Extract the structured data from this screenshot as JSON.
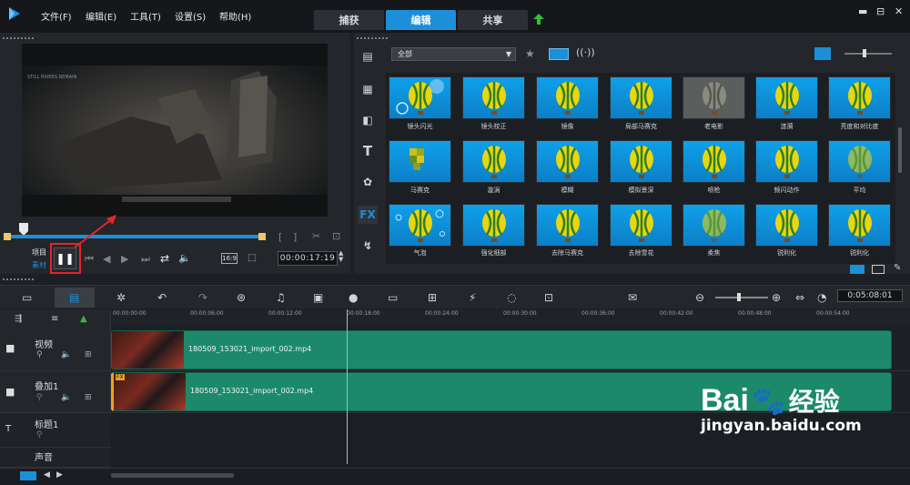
{
  "menu": [
    "文件(F)",
    "编辑(E)",
    "工具(T)",
    "设置(S)",
    "帮助(H)"
  ],
  "tabs": [
    "捕获",
    "编辑",
    "共享"
  ],
  "active_tab": "编辑",
  "window": {
    "min": "▬",
    "restore": "⊟",
    "close": "✕"
  },
  "preview": {
    "project_label": "项目",
    "clip_label": "素材",
    "timecode": "00:00:17:19",
    "ratio": "16:9",
    "watermark_text": "STILL RIVERS REMAIN"
  },
  "library": {
    "filter_value": "全部",
    "side_tabs": [
      "media-icon",
      "instant-project-icon",
      "transition-icon",
      "title-icon",
      "graphic-icon",
      "FX",
      "path-icon"
    ],
    "fx_label": "FX",
    "effects": [
      [
        "镜头闪光",
        "镜头校正",
        "镜像",
        "局部马赛克",
        "老电影",
        "涟漪",
        "亮度和对比度"
      ],
      [
        "马赛克",
        "漩涡",
        "模糊",
        "模拟景深",
        "喷枪",
        "频闪动作",
        "平均"
      ],
      [
        "气泡",
        "强化细部",
        "去除马赛克",
        "去除雪花",
        "柔焦",
        "锐利化",
        "锐利化"
      ]
    ]
  },
  "timeline": {
    "timecode": "0:05:08:01",
    "ruler": [
      "00:00:00:00",
      "00:00:06:00",
      "00:00:12:00",
      "00:00:18:00",
      "00:00:24:00",
      "00:00:30:00",
      "00:00:36:00",
      "00:00:42:00",
      "00:00:48:00",
      "00:00:54:00"
    ],
    "tracks": [
      {
        "name": "视频",
        "clip": "180509_153021_import_002.mp4"
      },
      {
        "name": "叠加1",
        "clip": "180509_153021_import_002.mp4",
        "fx_badge": "FX"
      },
      {
        "name": "标题1",
        "clip": ""
      },
      {
        "name": "声音",
        "clip": ""
      }
    ]
  },
  "watermark": {
    "brand": "Bai",
    "brand_cn": "经验",
    "url": "jingyan.baidu.com"
  }
}
